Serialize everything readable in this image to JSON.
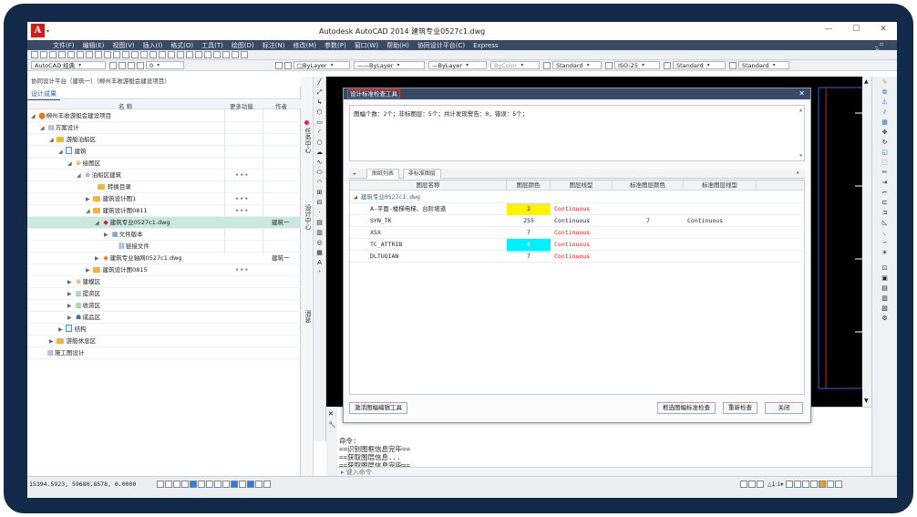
{
  "window": {
    "title": "Autodesk AutoCAD 2014   建筑专业0527c1.dwg"
  },
  "menu": [
    "文件(F)",
    "编辑(E)",
    "视图(V)",
    "插入(I)",
    "格式(O)",
    "工具(T)",
    "绘图(D)",
    "标注(N)",
    "修改(M)",
    "参数(P)",
    "窗口(W)",
    "帮助(H)",
    "协同设计平台(C)",
    "Express"
  ],
  "toolbar2": {
    "workspace": "AutoCAD 经典",
    "layer": "ByLayer",
    "color_combo": "ByLayer",
    "linetype_combo": "ByLayer",
    "plot_style": "ByColor",
    "text_style": "Standard",
    "dim_style": "ISO-25",
    "table_style": "Standard",
    "multileader_style": "Standard",
    "layer_state": "0"
  },
  "left_panel": {
    "header": "协同设计平台（建筑一）（柳州丰收游艇会建设项目）",
    "tab": "设计成果",
    "columns": {
      "name": "名 称",
      "more": "更多功能",
      "author": "作者"
    },
    "tree": [
      {
        "label": "柳州丰收游艇会建设项目",
        "indent": 4,
        "arrow": "◢",
        "icon": "proj"
      },
      {
        "label": "方案设计",
        "indent": 14,
        "arrow": "◢",
        "icon": "plan"
      },
      {
        "label": "游艇泊船区",
        "indent": 24,
        "arrow": "◢",
        "icon": "fold"
      },
      {
        "label": "建筑",
        "indent": 34,
        "arrow": "◢",
        "icon": "doc"
      },
      {
        "label": "绘图区",
        "indent": 44,
        "arrow": "◢",
        "icon": "gear"
      },
      {
        "label": "泊船区建筑",
        "indent": 54,
        "arrow": "◢",
        "icon": "gear2",
        "more": "•••"
      },
      {
        "label": "转换目录",
        "indent": 70,
        "arrow": "",
        "icon": "fold"
      },
      {
        "label": "建筑设计图1",
        "indent": 64,
        "arrow": "▶",
        "icon": "fold",
        "more": "•••"
      },
      {
        "label": "建筑设计图0811",
        "indent": 64,
        "arrow": "◢",
        "icon": "fold",
        "more": "•••"
      },
      {
        "label": "建筑专业0527c1.dwg",
        "indent": 74,
        "arrow": "◢",
        "icon": "dwg",
        "author": "建筑一",
        "selected": true
      },
      {
        "label": "文件版本",
        "indent": 84,
        "arrow": "▶",
        "icon": "ver"
      },
      {
        "label": "链接文件",
        "indent": 92,
        "arrow": "",
        "icon": "link"
      },
      {
        "label": "建筑专业轴网0527c1.dwg",
        "indent": 74,
        "arrow": "▶",
        "icon": "dwg2",
        "author": "建筑一"
      },
      {
        "label": "建筑设计图0815",
        "indent": 64,
        "arrow": "▶",
        "icon": "fold",
        "more": "•••"
      },
      {
        "label": "建模区",
        "indent": 44,
        "arrow": "▶",
        "icon": "gear"
      },
      {
        "label": "提资区",
        "indent": 44,
        "arrow": "▶",
        "icon": "tizi"
      },
      {
        "label": "收资区",
        "indent": 44,
        "arrow": "▶",
        "icon": "tizi"
      },
      {
        "label": "成品区",
        "indent": 44,
        "arrow": "▶",
        "icon": "people"
      },
      {
        "label": "结构",
        "indent": 34,
        "arrow": "▶",
        "icon": "doc"
      },
      {
        "label": "游艇休息区",
        "indent": 24,
        "arrow": "▶",
        "icon": "fold"
      },
      {
        "label": "施工图设计",
        "indent": 14,
        "arrow": "",
        "icon": "plan"
      }
    ]
  },
  "side_labels": {
    "strip1": "任务中心",
    "strip2a": "设计中心",
    "strip2b": "消息"
  },
  "dialog": {
    "title": "设计标准检查工具",
    "summary": "图幅个数：2个；非标图层：5个；共计发现警告：0，错误：5个；",
    "tabs": [
      "图纸列表",
      "非标准图层"
    ],
    "columns": [
      "图层名称",
      "图层颜色",
      "图层线型",
      "标准图层颜色",
      "标准图层线型"
    ],
    "group": "建筑专业0527c1.dwg",
    "rows": [
      {
        "name": "A-平面-楼梯电梯、台阶坡道",
        "color": "2",
        "color_bg": "#fff200",
        "linetype": "Continuous",
        "lt_red": true,
        "std_color": "",
        "std_lt": ""
      },
      {
        "name": "SYN_TK",
        "color": "255",
        "color_bg": "",
        "linetype": "Continuous",
        "lt_red": false,
        "std_color": "7",
        "std_lt": "Continuous"
      },
      {
        "name": "XSX",
        "color": "7",
        "color_bg": "",
        "linetype": "Continuous",
        "lt_red": true,
        "std_color": "",
        "std_lt": ""
      },
      {
        "name": "TC_ATTRIB",
        "color": "4",
        "color_bg": "#00f0ff",
        "linetype": "Continuous",
        "lt_red": true,
        "std_color": "",
        "std_lt": ""
      },
      {
        "name": "DLTUQIAN",
        "color": "7",
        "color_bg": "",
        "linetype": "Continuous",
        "lt_red": true,
        "std_color": "",
        "std_lt": ""
      }
    ],
    "buttons": {
      "open_editor": "激活图幅编辑工具",
      "filter": "框选图幅标准检查",
      "recheck": "重新检查",
      "close": "关闭"
    }
  },
  "command": {
    "lines": [
      "命令:",
      "==识别图框信息完毕==",
      "==获取图层信息...",
      "==获取图层信息完毕=="
    ],
    "placeholder": "键入命令"
  },
  "status": {
    "coords": "15394.5923, 59680.8578, 0.0000"
  },
  "colors": {
    "accent": "#2b5fa8",
    "error_red": "#e01e1e",
    "selection": "#cbe8df",
    "titlebar": "#374a67"
  }
}
